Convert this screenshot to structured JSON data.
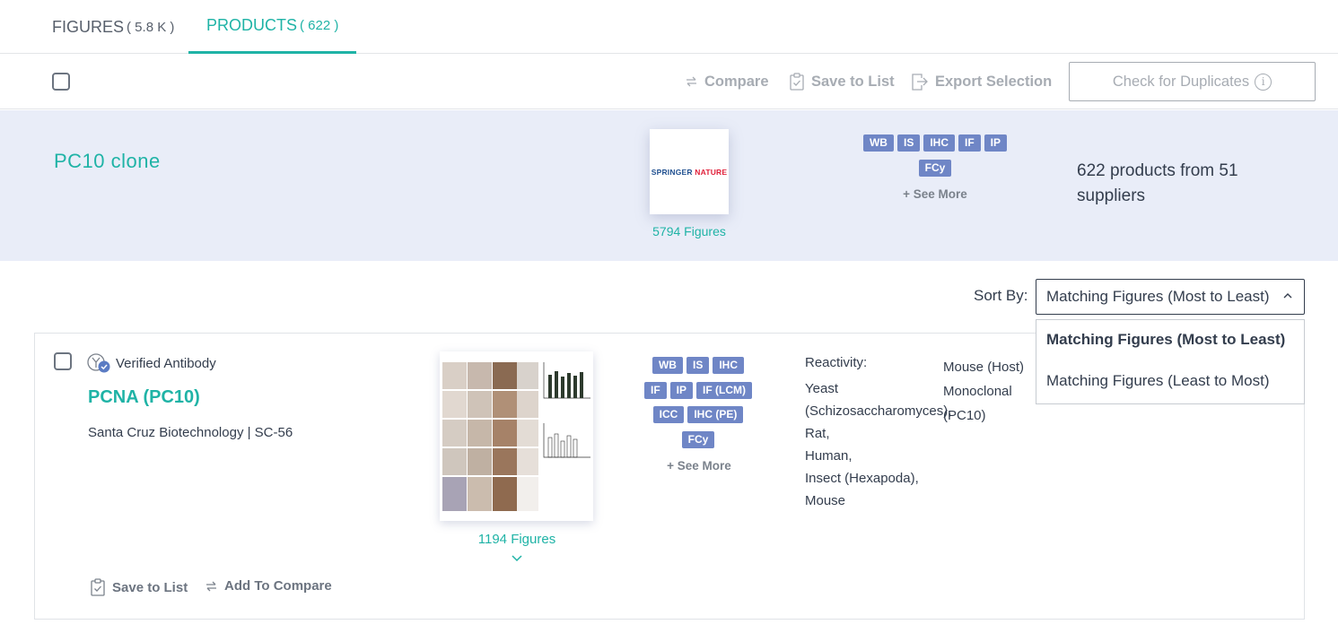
{
  "tabs": [
    {
      "label": "FIGURES",
      "count": "( 5.8 K )"
    },
    {
      "label": "PRODUCTS",
      "count": "( 622 )"
    }
  ],
  "toolbar": {
    "compare_label": "Compare",
    "save_label": "Save to List",
    "export_label": "Export Selection",
    "duplicates_label": "Check for Duplicates",
    "info_glyph": "i"
  },
  "banner": {
    "title": "PC10 clone",
    "logo_part1": "SPRINGER ",
    "logo_part2": "NATURE",
    "figures": "5794 Figures",
    "tags_row1": [
      "WB",
      "IS",
      "IHC",
      "IF",
      "IP"
    ],
    "tags_row2": [
      "FCy"
    ],
    "see_more": "+ See More",
    "summary": "622 products from 51 suppliers"
  },
  "sort": {
    "label": "Sort By:",
    "selected": "Matching Figures (Most to Least)",
    "options": [
      "Matching Figures (Most to Least)",
      "Matching Figures (Least to Most)"
    ]
  },
  "product": {
    "verified_label": "Verified Antibody",
    "title": "PCNA (PC10)",
    "supplier": "Santa Cruz Biotechnology | SC-56",
    "figures": "1194 Figures",
    "tags_rows": [
      [
        "WB",
        "IS",
        "IHC"
      ],
      [
        "IF",
        "IP",
        "IF (LCM)"
      ],
      [
        "ICC",
        "IHC (PE)"
      ],
      [
        "FCy"
      ]
    ],
    "see_more": "+ See More",
    "reactivity_label": "Reactivity:",
    "reactivity": [
      "Yeast",
      "(Schizosaccharomyces),",
      "Rat,",
      "Human,",
      "Insect (Hexapoda),",
      "Mouse"
    ],
    "host": "Mouse (Host)",
    "clonality": "Monoclonal",
    "clone": "(PC10)",
    "save_label": "Save to List",
    "compare_label": "Add To Compare"
  },
  "colors": {
    "accent": "#1fb3a6",
    "tag_bg": "#6f86c6",
    "banner_bg": "#e9edf8",
    "text": "#333d4d",
    "muted": "#a7acb3"
  },
  "icons": [
    "compare-arrows-icon",
    "clipboard-check-icon",
    "export-icon",
    "info-icon",
    "verified-antibody-icon",
    "chevron-up-icon",
    "chevron-down-icon"
  ]
}
